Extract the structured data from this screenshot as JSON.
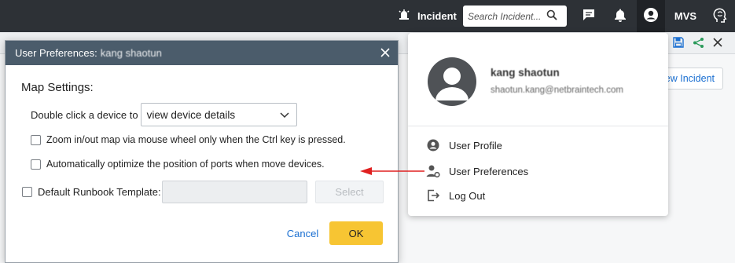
{
  "topbar": {
    "incident_label": "Incident",
    "search_placeholder": "Search Incident...",
    "user_initials": "MVS",
    "icons": [
      "incident-icon",
      "search-icon",
      "chat-icon",
      "bell-icon",
      "user-icon",
      "brain-icon"
    ]
  },
  "background": {
    "new_incident_label": "iew Incident",
    "tools": [
      "save-icon",
      "share-icon",
      "close-icon"
    ]
  },
  "dialog": {
    "title_prefix": "User Preferences:",
    "title_user": "kang shaotun",
    "section_title": "Map Settings:",
    "double_click_label": "Double click a device to",
    "double_click_value": "view device details",
    "zoom_option": "Zoom in/out map via mouse wheel only when the Ctrl key is pressed.",
    "optimize_option": "Automatically optimize the position of ports when move devices.",
    "runbook_label": "Default Runbook Template:",
    "runbook_value": "",
    "select_label": "Select",
    "cancel_label": "Cancel",
    "ok_label": "OK"
  },
  "user_menu": {
    "name": "kang shaotun",
    "email": "shaotun.kang@netbraintech.com",
    "items": [
      {
        "label": "User Profile",
        "icon": "user-circle-icon"
      },
      {
        "label": "User Preferences",
        "icon": "user-settings-icon"
      },
      {
        "label": "Log Out",
        "icon": "logout-icon"
      }
    ]
  },
  "colors": {
    "topbar": "#2d3136",
    "dialog_header": "#4b5c6b",
    "ok_button": "#f7c533",
    "link": "#1a6fd1",
    "arrow": "#e02020"
  }
}
